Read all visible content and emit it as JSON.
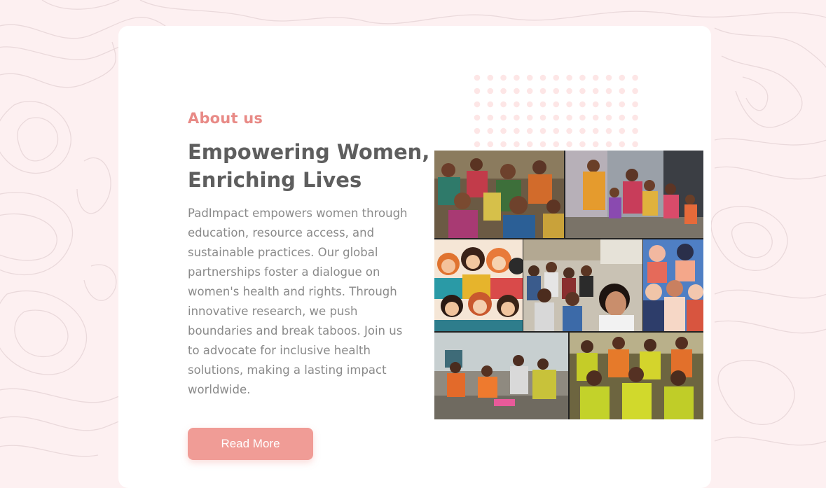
{
  "about": {
    "eyebrow": "About us",
    "heading_lines": [
      "Empowering Women,",
      "Enriching Lives"
    ],
    "body_lines": [
      "PadImpact empowers women through",
      "education, resource access, and",
      "sustainable practices. Our global",
      "partnerships foster a dialogue on",
      "women's health and rights. Through",
      "innovative research, we push",
      "boundaries and break taboos. Join us",
      "to advocate for inclusive health",
      "solutions, making a lasting impact",
      "worldwide."
    ],
    "button_label": "Read More"
  },
  "collage": {
    "photos": [
      "women-group-seated-photo",
      "women-children-doorway-photo",
      "illustrated-women-crowd",
      "classroom-students-selfie-photo",
      "illustrated-diverse-women",
      "women-workshop-floor-photo",
      "women-yellow-saris-photo"
    ]
  },
  "colors": {
    "accent": "#e88a86",
    "button": "#f09c96",
    "heading": "#5e5e5e",
    "body": "#8a8a8a",
    "page_bg": "#fdf0f1",
    "dots": "#fde6e6"
  }
}
